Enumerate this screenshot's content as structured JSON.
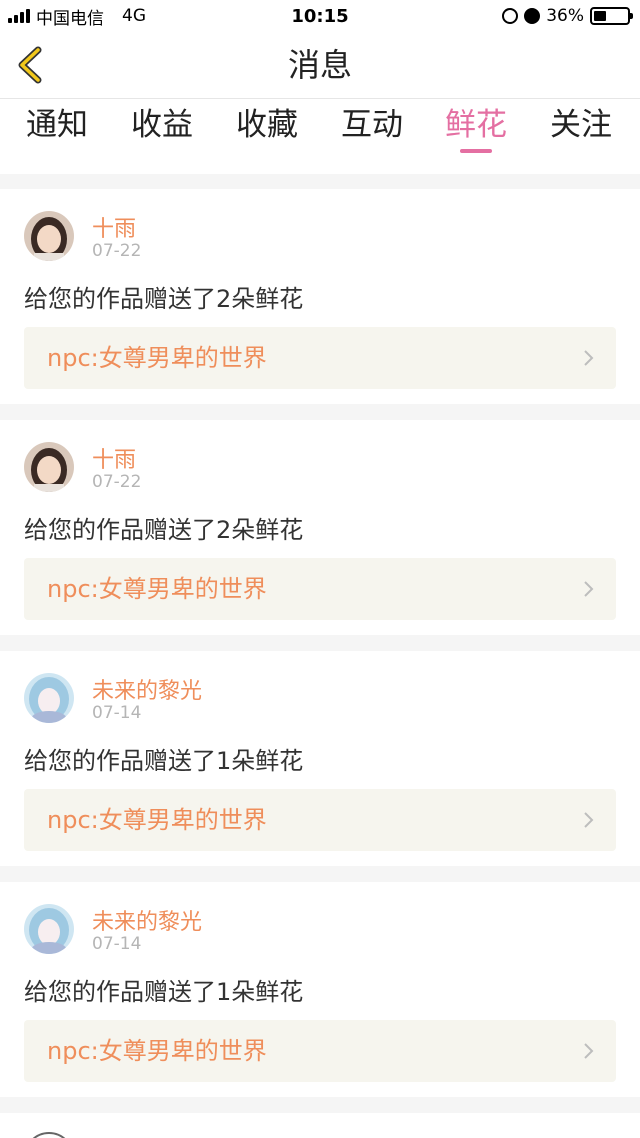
{
  "status_bar": {
    "carrier": "中国电信",
    "network": "4G",
    "time": "10:15",
    "battery_percent": "36%",
    "battery_level": 0.36
  },
  "nav": {
    "title": "消息",
    "back_icon": "chevron-left-icon"
  },
  "tabs": [
    {
      "label": "通知",
      "active": false
    },
    {
      "label": "收益",
      "active": false
    },
    {
      "label": "收藏",
      "active": false
    },
    {
      "label": "互动",
      "active": false
    },
    {
      "label": "鲜花",
      "active": true
    },
    {
      "label": "关注",
      "active": false
    }
  ],
  "colors": {
    "accent": "#e46fa2",
    "name": "#ef8e5b",
    "date": "#b5b5b5",
    "work_bg": "#f6f5ee"
  },
  "messages": [
    {
      "user": "十雨",
      "date": "07-22",
      "text": "给您的作品赠送了2朵鲜花",
      "work": "npc:女尊男卑的世界"
    },
    {
      "user": "十雨",
      "date": "07-22",
      "text": "给您的作品赠送了2朵鲜花",
      "work": "npc:女尊男卑的世界"
    },
    {
      "user": "未来的黎光",
      "date": "07-14",
      "text": "给您的作品赠送了1朵鲜花",
      "work": "npc:女尊男卑的世界"
    },
    {
      "user": "未来的黎光",
      "date": "07-14",
      "text": "给您的作品赠送了1朵鲜花",
      "work": "npc:女尊男卑的世界"
    }
  ]
}
